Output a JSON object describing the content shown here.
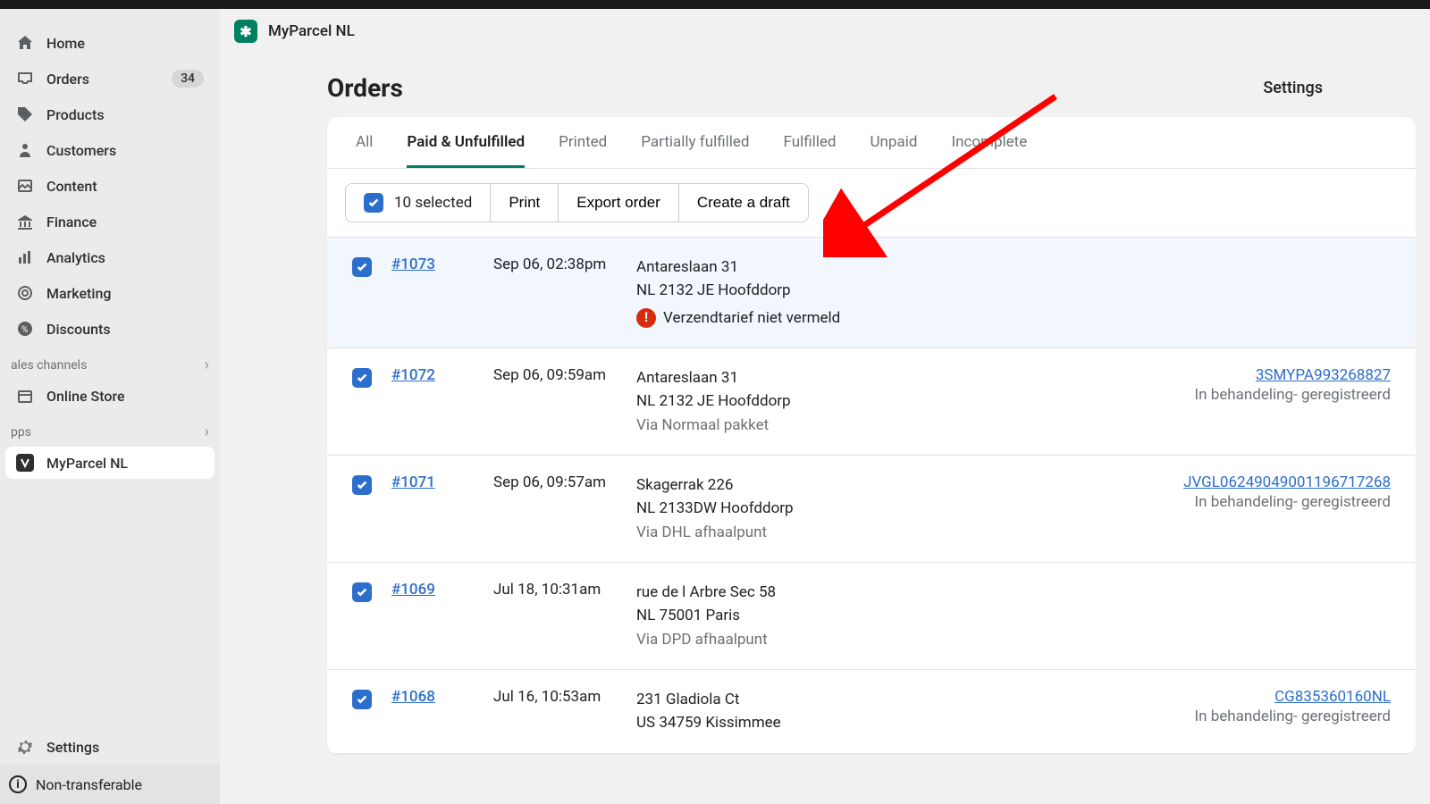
{
  "sidebar": {
    "items": [
      {
        "label": "Home"
      },
      {
        "label": "Orders",
        "badge": "34"
      },
      {
        "label": "Products"
      },
      {
        "label": "Customers"
      },
      {
        "label": "Content"
      },
      {
        "label": "Finance"
      },
      {
        "label": "Analytics"
      },
      {
        "label": "Marketing"
      },
      {
        "label": "Discounts"
      }
    ],
    "sales_channels_label": "ales channels",
    "online_store_label": "Online Store",
    "apps_label": "pps",
    "app_item_label": "MyParcel NL",
    "settings_label": "Settings",
    "nontransferable_label": "Non-transferable"
  },
  "header": {
    "app_title": "MyParcel NL",
    "app_logo_glyph": "✱"
  },
  "page": {
    "title": "Orders",
    "settings_label": "Settings"
  },
  "tabs": [
    {
      "label": "All"
    },
    {
      "label": "Paid & Unfulfilled",
      "active": true
    },
    {
      "label": "Printed"
    },
    {
      "label": "Partially fulfilled"
    },
    {
      "label": "Fulfilled"
    },
    {
      "label": "Unpaid"
    },
    {
      "label": "Incomplete"
    }
  ],
  "toolbar": {
    "selected_label": "10 selected",
    "print_label": "Print",
    "export_label": "Export order",
    "draft_label": "Create a draft"
  },
  "orders": [
    {
      "order": "#1073",
      "date": "Sep 06, 02:38pm",
      "addr1": "Antareslaan 31",
      "addr2": "NL 2132 JE Hoofddorp",
      "warning": "Verzendtarief niet vermeld"
    },
    {
      "order": "#1072",
      "date": "Sep 06, 09:59am",
      "addr1": "Antareslaan 31",
      "addr2": "NL 2132 JE Hoofddorp",
      "meta": "Via Normaal pakket",
      "tracking": "3SMYPA993268827",
      "status": "In behandeling- geregistreerd"
    },
    {
      "order": "#1071",
      "date": "Sep 06, 09:57am",
      "addr1": "Skagerrak 226",
      "addr2": "NL 2133DW Hoofddorp",
      "meta": "Via DHL afhaalpunt",
      "tracking": "JVGL06249049001196717268",
      "status": "In behandeling- geregistreerd"
    },
    {
      "order": "#1069",
      "date": "Jul 18, 10:31am",
      "addr1": "rue de l Arbre Sec 58",
      "addr2": "NL 75001 Paris",
      "meta": "Via DPD afhaalpunt"
    },
    {
      "order": "#1068",
      "date": "Jul 16, 10:53am",
      "addr1": "231 Gladiola Ct",
      "addr2": "US 34759 Kissimmee",
      "tracking": "CG835360160NL",
      "status": "In behandeling- geregistreerd"
    }
  ]
}
